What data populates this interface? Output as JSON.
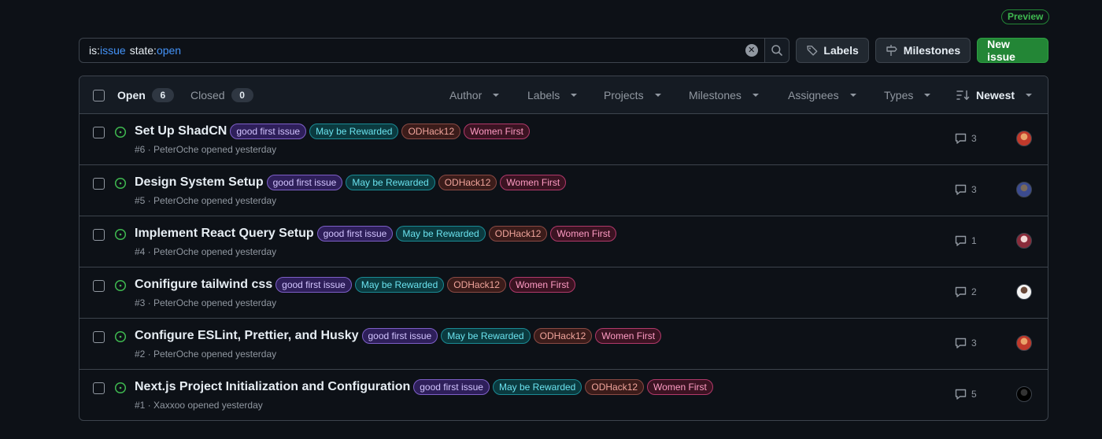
{
  "preview_badge": "Preview",
  "search": {
    "tokens": [
      {
        "key": "is:",
        "value": "issue"
      },
      {
        "key": "state:",
        "value": "open"
      }
    ]
  },
  "toolbar": {
    "labels_label": "Labels",
    "milestones_label": "Milestones",
    "new_issue_label": "New issue"
  },
  "header": {
    "open_label": "Open",
    "open_count": "6",
    "closed_label": "Closed",
    "closed_count": "0",
    "filters": [
      "Author",
      "Labels",
      "Projects",
      "Milestones",
      "Assignees",
      "Types"
    ],
    "sort_label": "Newest"
  },
  "label_names": {
    "good_first_issue": "good first issue",
    "may_be_rewarded": "May be Rewarded",
    "odhack": "ODHack12",
    "women_first": "Women First"
  },
  "issues": [
    {
      "title": "Set Up ShadCN",
      "meta": "#6 · PeterOche opened yesterday",
      "comments": "3",
      "avatar_colors": [
        "#c0392b",
        "#e9a36a"
      ]
    },
    {
      "title": "Design System Setup",
      "meta": "#5 · PeterOche opened yesterday",
      "comments": "3",
      "avatar_colors": [
        "#3b4b8f",
        "#7a6a5a"
      ]
    },
    {
      "title": "Implement React Query Setup",
      "meta": "#4 · PeterOche opened yesterday",
      "comments": "1",
      "avatar_colors": [
        "#8a2b3a",
        "#f2d7d5"
      ]
    },
    {
      "title": "Conifigure tailwind css",
      "meta": "#3 · PeterOche opened yesterday",
      "comments": "2",
      "avatar_colors": [
        "#f5f5f5",
        "#6b4a3a"
      ]
    },
    {
      "title": "Configure ESLint, Prettier, and Husky",
      "meta": "#2 · PeterOche opened yesterday",
      "comments": "3",
      "avatar_colors": [
        "#c0392b",
        "#e9a36a"
      ]
    },
    {
      "title": "Next.js Project Initialization and Configuration",
      "meta": "#1 · Xaxxoo opened yesterday",
      "comments": "5",
      "avatar_colors": [
        "#000000",
        "#333333"
      ]
    }
  ]
}
